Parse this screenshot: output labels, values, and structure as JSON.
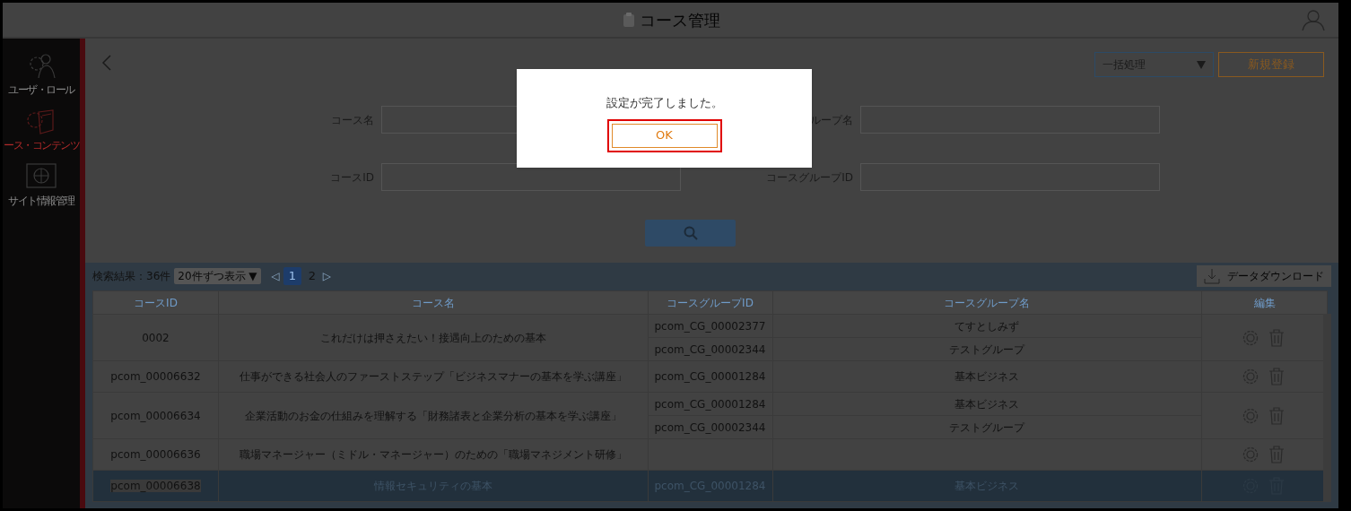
{
  "header": {
    "title": "コース管理"
  },
  "sidebar": {
    "items": [
      {
        "label": "ユーザ・ロール",
        "kind": "users",
        "selected": false
      },
      {
        "label": "ース・コンテンツ",
        "kind": "contents",
        "selected": true
      },
      {
        "label": "サイト情報管理",
        "kind": "site",
        "selected": false
      }
    ]
  },
  "toolbar": {
    "bulk_select": "一括処理",
    "new_button": "新規登録"
  },
  "search_form": {
    "fields": [
      {
        "label": "コース名"
      },
      {
        "label": "ループ名"
      },
      {
        "label": "コースID"
      },
      {
        "label": "コースグループID"
      }
    ]
  },
  "results": {
    "count": "検索結果：36件",
    "page_size": "20件ずつ表示 ▼",
    "prev": "◁",
    "next": "▷",
    "pages": [
      {
        "label": "1",
        "selected": true
      },
      {
        "label": "2",
        "selected": false
      }
    ],
    "download": "データダウンロード"
  },
  "table": {
    "columns": [
      "コースID",
      "コース名",
      "コースグループID",
      "コースグループ名",
      "編集"
    ],
    "rows": [
      {
        "course_id": "0002",
        "course_name": "これだけは押さえたい！接遇向上のための基本",
        "selected": false,
        "groups": [
          {
            "id": "pcom_CG_00002377",
            "name": "てすとしみず"
          },
          {
            "id": "pcom_CG_00002344",
            "name": "テストグループ"
          }
        ]
      },
      {
        "course_id": "pcom_00006632",
        "course_name": "仕事ができる社会人のファーストステップ「ビジネスマナーの基本を学ぶ講座」",
        "selected": false,
        "groups": [
          {
            "id": "pcom_CG_00001284",
            "name": "基本ビジネス"
          }
        ]
      },
      {
        "course_id": "pcom_00006634",
        "course_name": "企業活動のお金の仕組みを理解する「財務諸表と企業分析の基本を学ぶ講座」",
        "selected": false,
        "groups": [
          {
            "id": "pcom_CG_00001284",
            "name": "基本ビジネス"
          },
          {
            "id": "pcom_CG_00002344",
            "name": "テストグループ"
          }
        ]
      },
      {
        "course_id": "pcom_00006636",
        "course_name": "職場マネージャー（ミドル・マネージャー）のための「職場マネジメント研修」",
        "selected": false,
        "groups": []
      },
      {
        "course_id": "pcom_00006638",
        "course_name": "情報セキュリティの基本",
        "selected": true,
        "groups": [
          {
            "id": "pcom_CG_00001284",
            "name": "基本ビジネス"
          }
        ]
      }
    ]
  },
  "dialog": {
    "message": "設定が完了しました。",
    "ok": "OK"
  }
}
